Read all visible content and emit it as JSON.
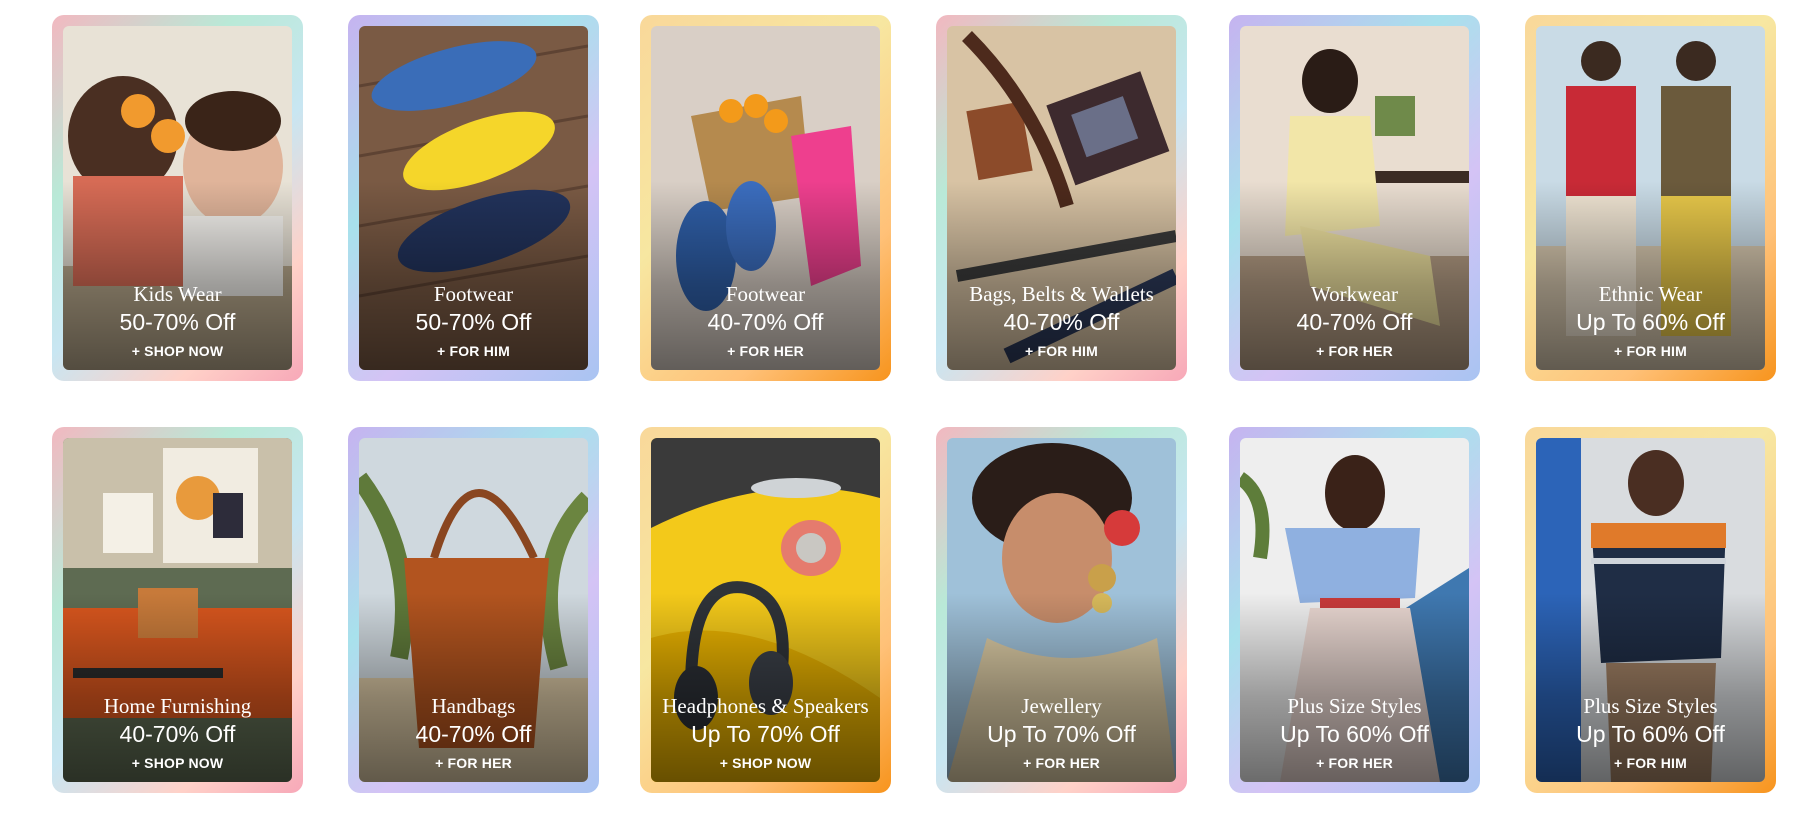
{
  "tiles": [
    {
      "category": "Kids Wear",
      "offer": "50-70% Off",
      "cta": "+ SHOP NOW"
    },
    {
      "category": "Footwear",
      "offer": "50-70% Off",
      "cta": "+ FOR HIM"
    },
    {
      "category": "Footwear",
      "offer": "40-70% Off",
      "cta": "+ FOR HER"
    },
    {
      "category": "Bags, Belts & Wallets",
      "offer": "40-70% Off",
      "cta": "+ FOR HIM"
    },
    {
      "category": "Workwear",
      "offer": "40-70% Off",
      "cta": "+ FOR HER"
    },
    {
      "category": "Ethnic Wear",
      "offer": "Up To 60% Off",
      "cta": "+ FOR HIM"
    },
    {
      "category": "Home Furnishing",
      "offer": "40-70% Off",
      "cta": "+ SHOP NOW"
    },
    {
      "category": "Handbags",
      "offer": "40-70% Off",
      "cta": "+ FOR HER"
    },
    {
      "category": "Headphones & Speakers",
      "offer": "Up To 70% Off",
      "cta": "+ SHOP NOW"
    },
    {
      "category": "Jewellery",
      "offer": "Up To 70% Off",
      "cta": "+ FOR HER"
    },
    {
      "category": "Plus Size Styles",
      "offer": "Up To 60% Off",
      "cta": "+ FOR HER"
    },
    {
      "category": "Plus Size Styles",
      "offer": "Up To 60% Off",
      "cta": "+ FOR HIM"
    }
  ]
}
